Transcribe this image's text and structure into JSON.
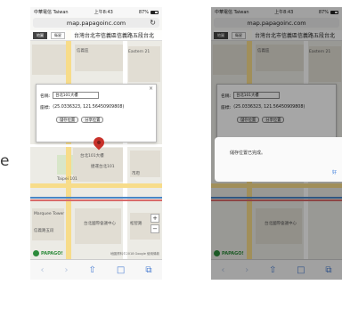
{
  "side_char": "e",
  "shared": {
    "status": {
      "carrier": "中華電信 Taiwan",
      "time": "上午8:43",
      "battery": "87%"
    },
    "url": "map.papagoinc.com",
    "page_title": "台灣台北市信義區信義路五段台北",
    "map_tabs": [
      "地圖",
      "衛星"
    ],
    "logo": "PAPAGO!",
    "attribution": "地圖資料©2018 Google 使用條款",
    "toolbar": {
      "back": "‹",
      "forward": "›",
      "share": "⇧",
      "bookmarks": "□",
      "tabs": "⧉"
    }
  },
  "phoneA": {
    "popup": {
      "name_label": "名稱:",
      "name_value": "台北101大樓",
      "coord_label": "座標:",
      "coord_value": "(25.0336323, 121.56450909808)",
      "button_add": "儲存位置",
      "button_share": "分享位置",
      "close": "×"
    },
    "labels": [
      "台北101大樓",
      "Eastern 21",
      "信義區",
      "市府",
      "捷運台北101",
      "松智路",
      "信義路五段",
      "松廉路",
      "Taipei 101",
      "Marquee Tower",
      "台北國際會議中心"
    ]
  },
  "phoneB": {
    "alert_message": "儲存位置已完成。",
    "alert_ok": "好",
    "labels": [
      "台北101大樓",
      "Eastern 21",
      "信義區",
      "Taipei 101",
      "台北國際會議中心"
    ]
  }
}
